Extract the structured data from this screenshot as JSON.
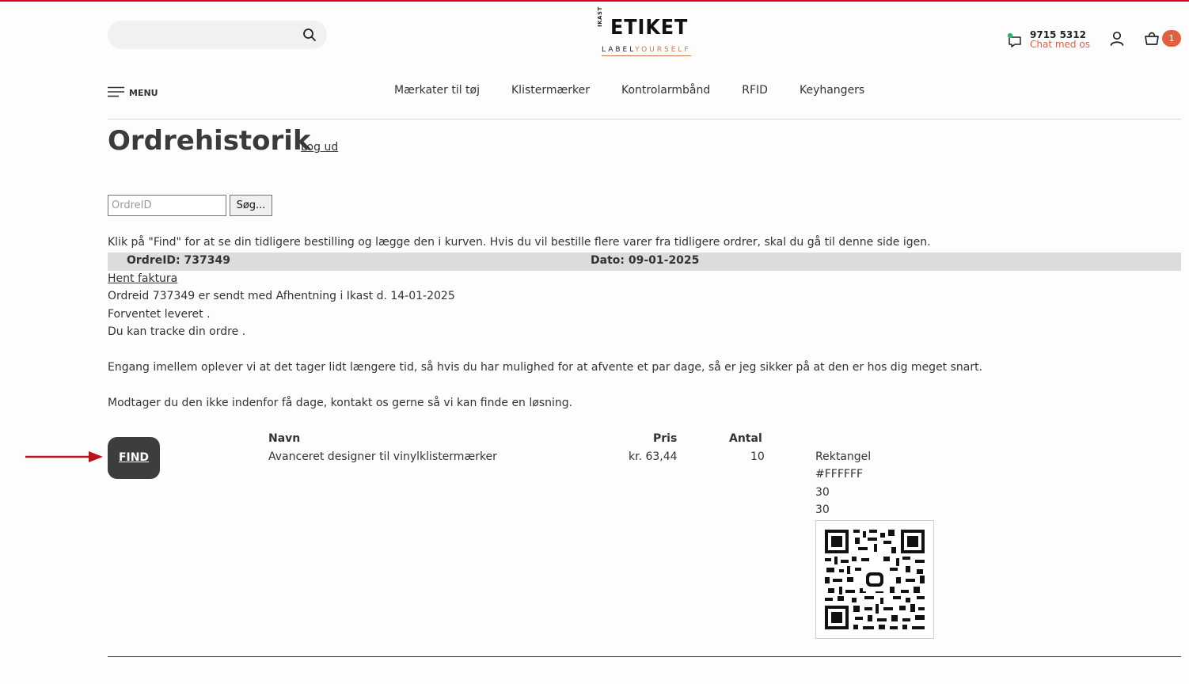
{
  "header": {
    "search_placeholder": "",
    "logo": {
      "top_small": "IKAST",
      "name": "ETIKET",
      "tagline_a": "LABEL",
      "tagline_b": "YOURSELF"
    },
    "phone": "9715 5312",
    "chat_label": "Chat med os",
    "cart_count": "1",
    "accent_color": "#e0613f"
  },
  "nav": {
    "menu_label": "MENU",
    "items": [
      "Mærkater til tøj",
      "Klistermærker",
      "Kontrolarmbånd",
      "RFID",
      "Keyhangers"
    ]
  },
  "page": {
    "title": "Ordrehistorik",
    "logout_label": "Log ud",
    "order_input_placeholder": "OrdreID",
    "search_button_label": "Søg...",
    "intro": "Klik på \"Find\" for at se din tidligere bestilling og lægge den i kurven. Hvis du vil bestille flere varer fra tidligere ordrer, skal du gå til denne side igen."
  },
  "order": {
    "id_label": "OrdreID: 737349",
    "date_label": "Dato: 09-01-2025",
    "invoice_link": "Hent faktura",
    "lines": [
      "Ordreid 737349 er sendt med Afhentning i Ikast d. 14-01-2025",
      "Forventet leveret .",
      "Du kan tracke din ordre .",
      "Engang imellem oplever vi at det tager lidt længere tid, så hvis du har mulighed for at afvente et par dage, så er jeg sikker på at den er hos dig meget snart.",
      "Modtager du den ikke indenfor få dage, kontakt os gerne så vi kan finde en løsning."
    ],
    "find_button_label": "FIND",
    "columns": {
      "name": "Navn",
      "price": "Pris",
      "qty": "Antal"
    },
    "item": {
      "name": "Avanceret designer til vinylklistermærker",
      "price": "kr. 63,44",
      "qty": "10",
      "props": [
        "Rektangel",
        "#FFFFFF",
        "30",
        "30"
      ]
    }
  }
}
